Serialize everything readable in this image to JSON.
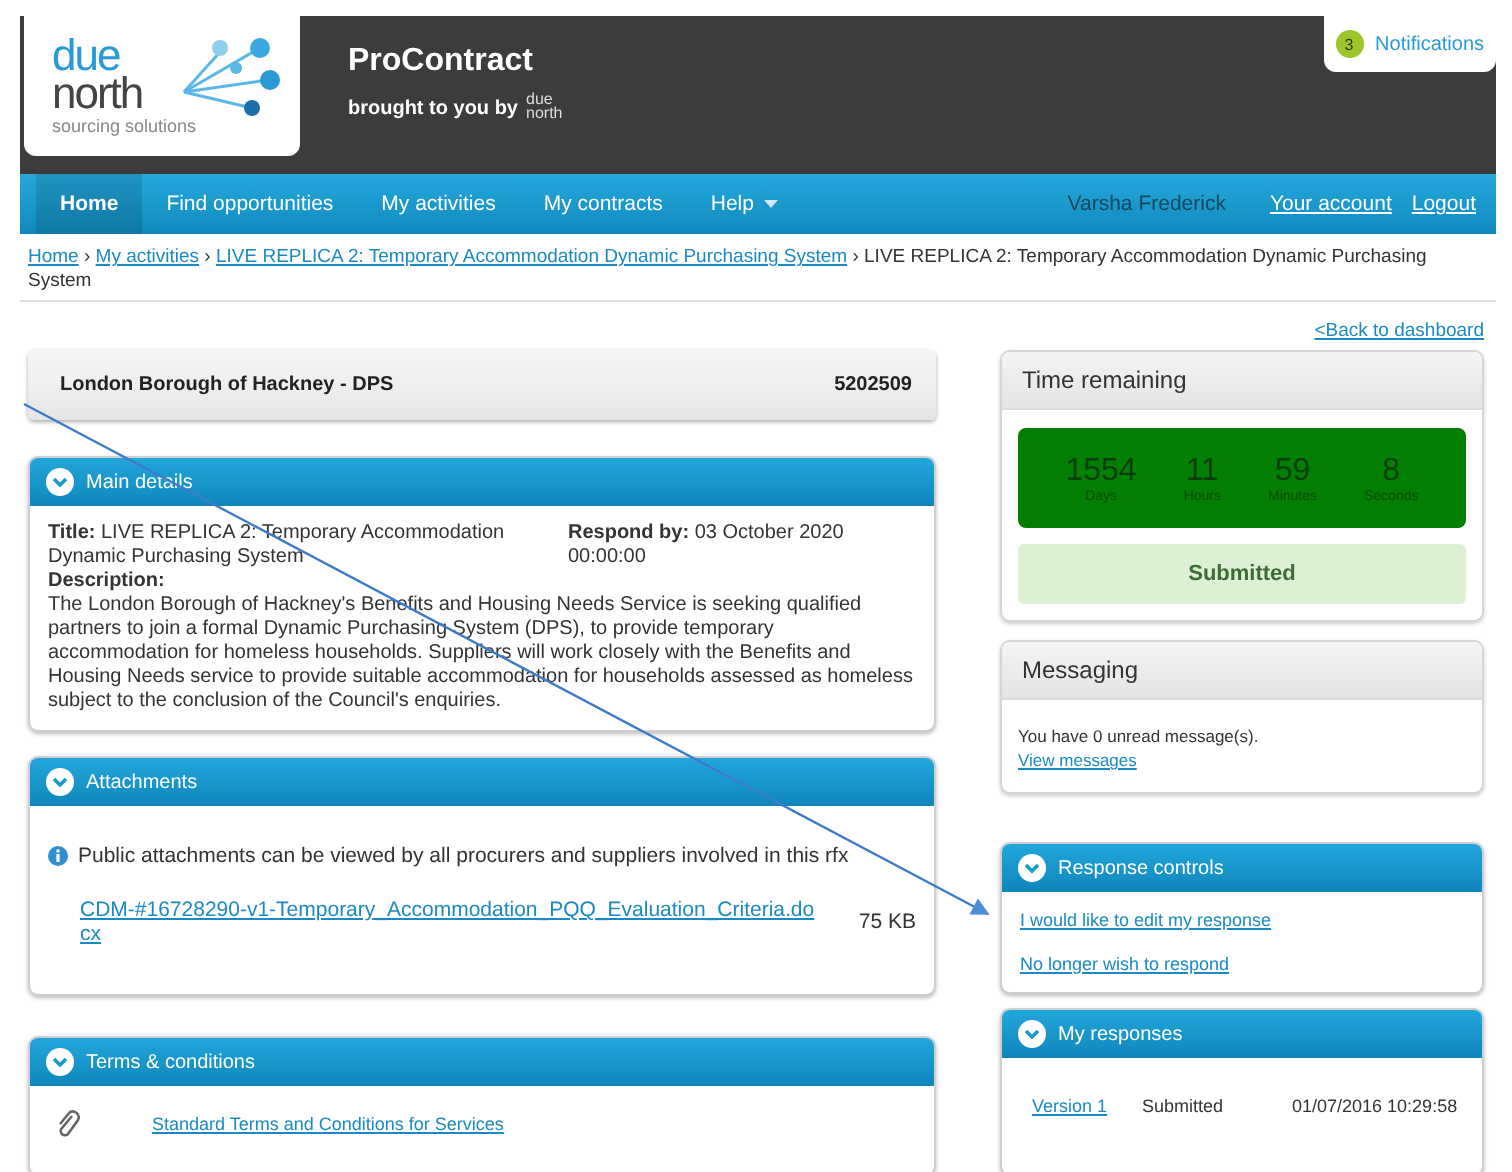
{
  "header": {
    "logo": {
      "line1": "due",
      "line2": "north",
      "tagline": "sourcing solutions"
    },
    "app_name": "ProContract",
    "brought_by": "brought to you by",
    "small_logo": {
      "line1": "due",
      "line2": "north"
    },
    "notifications": {
      "count": "3",
      "label": "Notifications"
    }
  },
  "nav": {
    "items": [
      {
        "label": "Home",
        "selected": true,
        "dropdown": false
      },
      {
        "label": "Find opportunities",
        "selected": false,
        "dropdown": false
      },
      {
        "label": "My activities",
        "selected": false,
        "dropdown": false
      },
      {
        "label": "My contracts",
        "selected": false,
        "dropdown": false
      },
      {
        "label": "Help",
        "selected": false,
        "dropdown": true
      }
    ],
    "user": "Varsha Frederick",
    "right_links": [
      "Your account",
      "Logout"
    ]
  },
  "breadcrumb": {
    "separator": "›",
    "items": [
      {
        "label": "Home",
        "link": true
      },
      {
        "label": "My activities",
        "link": true
      },
      {
        "label": "LIVE REPLICA 2: Temporary Accommodation Dynamic Purchasing System",
        "link": true
      },
      {
        "label": "LIVE REPLICA 2: Temporary Accommodation Dynamic Purchasing System",
        "link": false
      }
    ]
  },
  "back_link": "<Back to dashboard",
  "summary": {
    "name": "London Borough of Hackney - DPS",
    "reference": "5202509"
  },
  "main_details": {
    "title": "Main details",
    "title_line": "**Title:** LIVE REPLICA 2: Temporary Accommodation Dynamic Purchasing System",
    "respond_line": "**Respond by:** 03 October 2020 00:00:00",
    "description_label": "Description:",
    "description": "The London Borough of Hackney's Benefits and Housing Needs Service is seeking qualified partners to join a formal Dynamic Purchasing System (DPS), to provide temporary accommodation for homeless households. Suppliers will work closely with the Benefits and Housing Needs service to provide suitable accommodation for households assessed as homeless subject to the conclusion of the Council's enquiries."
  },
  "attachments": {
    "title": "Attachments",
    "info": "Public attachments can be viewed by all procurers and suppliers involved in this rfx",
    "files": [
      {
        "name": "CDM-#16728290-v1-Temporary_Accommodation_PQQ_Evaluation_Criteria.docx",
        "size": "75 KB"
      }
    ]
  },
  "terms": {
    "title": "Terms & conditions",
    "documents": [
      "Standard Terms and Conditions for Services"
    ]
  },
  "time_remaining": {
    "title": "Time remaining",
    "units": [
      {
        "value": "1554",
        "label": "Days"
      },
      {
        "value": "11",
        "label": "Hours"
      },
      {
        "value": "59",
        "label": "Minutes"
      },
      {
        "value": "8",
        "label": "Seconds"
      }
    ],
    "status": "Submitted"
  },
  "messaging": {
    "title": "Messaging",
    "text": "You have 0 unread message(s).",
    "link": "View messages"
  },
  "response_controls": {
    "title": "Response controls",
    "links": [
      "I would like to edit my response",
      "No longer wish to respond"
    ]
  },
  "my_responses": {
    "title": "My responses",
    "rows": [
      {
        "version": "Version 1",
        "status": "Submitted",
        "date": "01/07/2016 10:29:58"
      }
    ]
  }
}
